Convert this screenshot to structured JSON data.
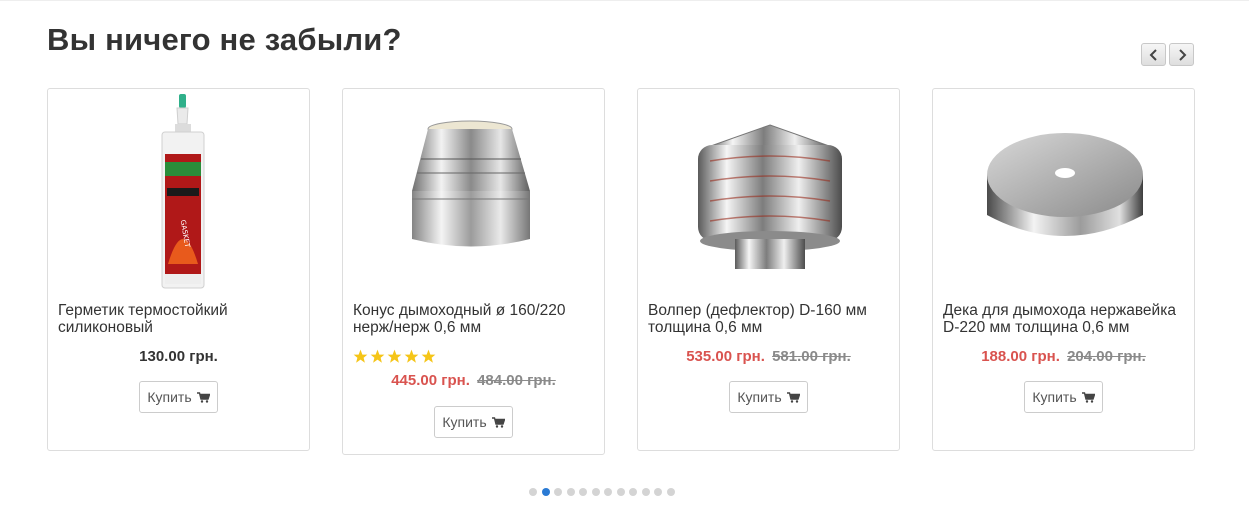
{
  "section": {
    "title": "Вы ничего не забыли?"
  },
  "nav": {
    "prev_icon": "chevron-left-icon",
    "next_icon": "chevron-right-icon"
  },
  "products": [
    {
      "name": "Герметик термостойкий силиконовый",
      "price": "130.00 грн.",
      "old_price": null,
      "rating": 0,
      "buy_label": "Купить",
      "image": "sealant-tube-image"
    },
    {
      "name": "Конус дымоходный ø 160/220 нерж/нерж 0,6 мм",
      "price": "445.00 грн.",
      "old_price": "484.00 грн.",
      "rating": 5,
      "buy_label": "Купить",
      "image": "chimney-cone-image"
    },
    {
      "name": "Волпер (дефлектор) D-160 мм толщина 0,6 мм",
      "price": "535.00 грн.",
      "old_price": "581.00 грн.",
      "rating": 0,
      "buy_label": "Купить",
      "image": "deflector-image"
    },
    {
      "name": "Дека для дымохода нержавейка D-220 мм толщина 0,6 мм",
      "price": "188.00 грн.",
      "old_price": "204.00 грн.",
      "rating": 0,
      "buy_label": "Купить",
      "image": "chimney-deck-image"
    }
  ],
  "pagination": {
    "total": 12,
    "active_index": 1
  },
  "colors": {
    "sale_price": "#d9534f",
    "active_dot": "#2a7ad4",
    "star": "#f5c518"
  }
}
